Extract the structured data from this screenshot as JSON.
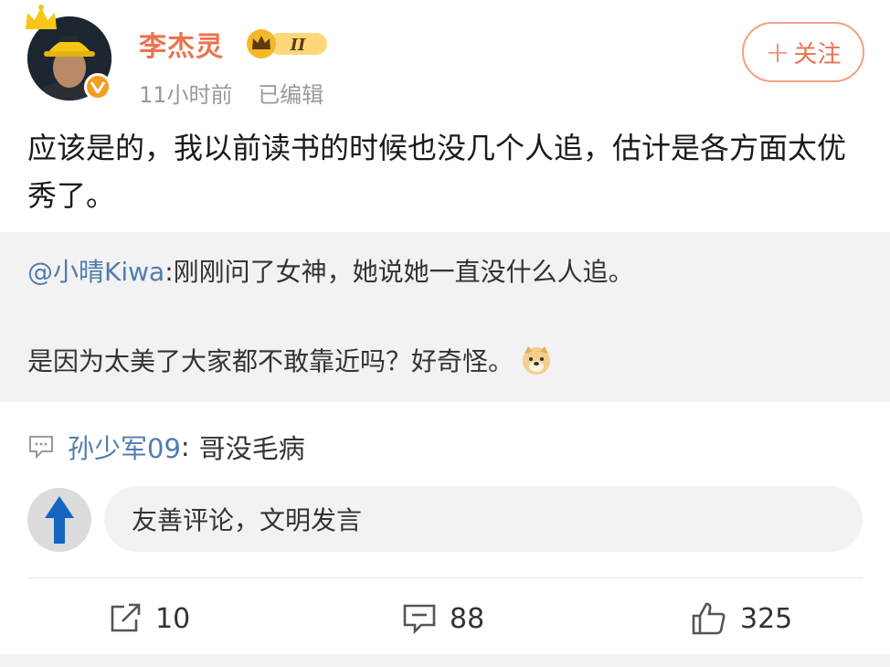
{
  "post": {
    "author": "李杰灵",
    "level_badge": "II",
    "time": "11小时前",
    "edited": "已编辑",
    "follow_label": "关注",
    "text": "应该是的，我以前读书的时候也没几个人追，估计是各方面太优秀了。"
  },
  "quoted": {
    "mention": "@小晴Kiwa",
    "line1": ":刚刚问了女神，她说她一直没什么人追。",
    "line2": "是因为太美了大家都不敢靠近吗？好奇怪。",
    "emoji": "doge-emoji"
  },
  "reply": {
    "user": "孙少军09",
    "separator": ":",
    "text": "哥没毛病"
  },
  "compose": {
    "placeholder": "友善评论，文明发言"
  },
  "actions": {
    "share_count": "10",
    "comment_count": "88",
    "like_count": "325"
  },
  "colors": {
    "accent": "#eb7350",
    "link": "#507daf",
    "vip_badge": "#f59d1f"
  }
}
